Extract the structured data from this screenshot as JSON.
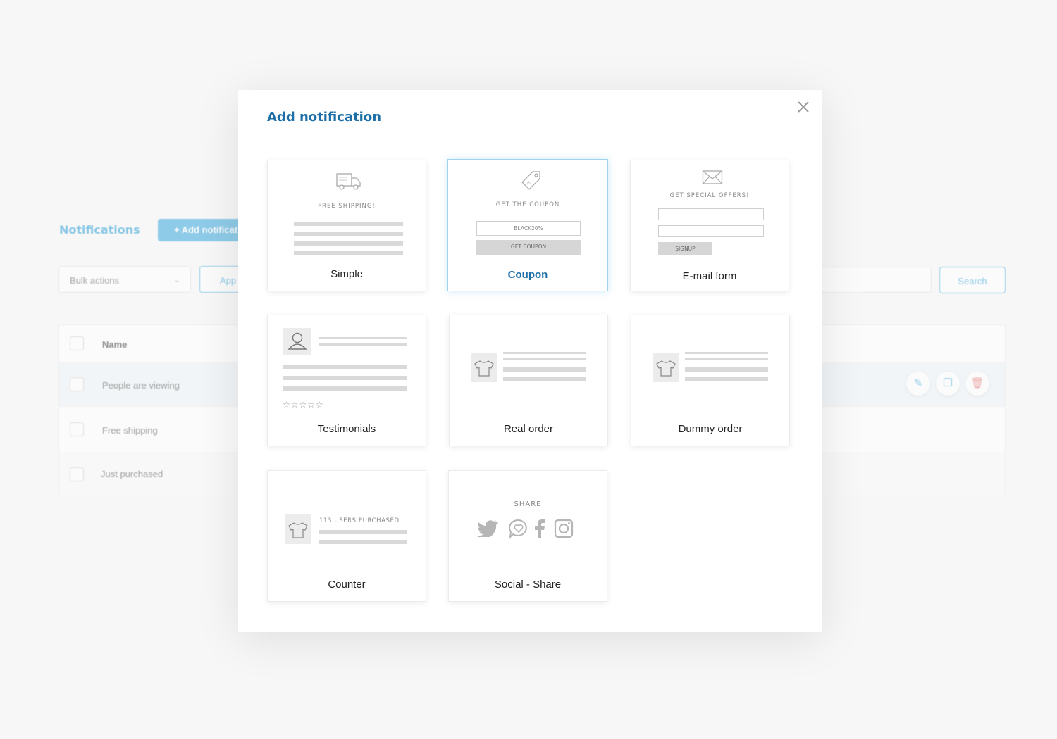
{
  "background": {
    "title": "Notifications",
    "add_button": "+ Add notificat",
    "bulk_actions": "Bulk actions",
    "apply_button": "App",
    "search_button": "Search",
    "table": {
      "header": "Name",
      "rows": [
        "People are viewing",
        "Free shipping",
        "Just purchased"
      ]
    }
  },
  "modal": {
    "title": "Add notification",
    "cards": {
      "simple": {
        "label": "Simple",
        "caption": "FREE SHIPPING!"
      },
      "coupon": {
        "label": "Coupon",
        "caption": "GET THE COUPON",
        "code": "BLACK20%",
        "button": "GET COUPON",
        "selected": true
      },
      "email": {
        "label": "E-mail form",
        "caption": "GET SPECIAL OFFERS!",
        "button": "SIGNUP"
      },
      "testimonials": {
        "label": "Testimonials",
        "stars": "☆☆☆☆☆"
      },
      "real_order": {
        "label": "Real order"
      },
      "dummy_order": {
        "label": "Dummy order"
      },
      "counter": {
        "label": "Counter",
        "caption": "113 USERS PURCHASED"
      },
      "social": {
        "label": "Social - Share",
        "caption": "SHARE"
      }
    }
  },
  "colors": {
    "accent": "#3aa8dc",
    "title": "#1e6fa8"
  }
}
